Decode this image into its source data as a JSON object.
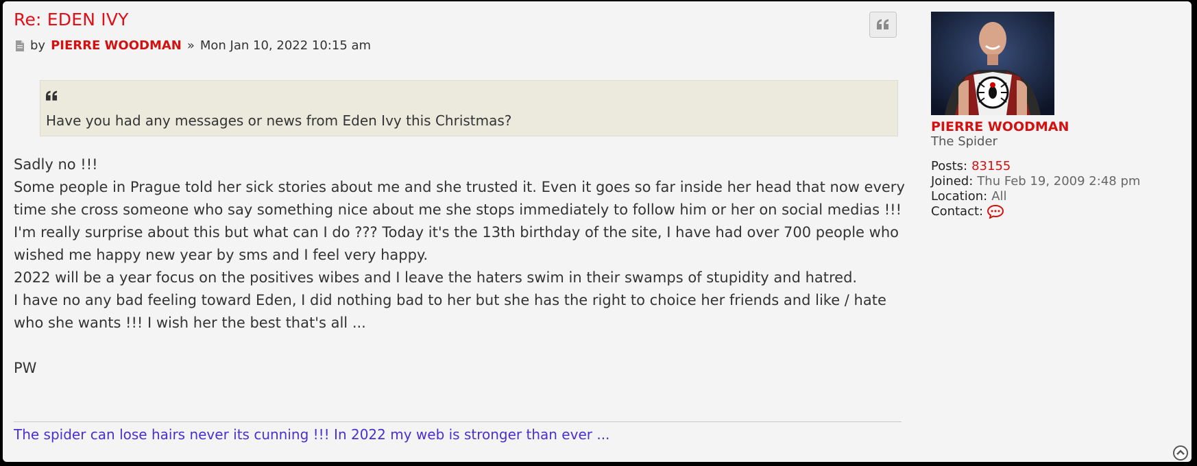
{
  "post": {
    "title": "Re: EDEN IVY",
    "by_label": "by",
    "author": "PIERRE WOODMAN",
    "separator": "»",
    "datetime": "Mon Jan 10, 2022 10:15 am"
  },
  "quote": {
    "text": "Have you had any messages or news from Eden Ivy this Christmas?"
  },
  "content": {
    "paragraphs": [
      "Sadly no !!!",
      "Some people in Prague told her sick stories about me and she trusted it. Even it goes so far inside her head that now every time she cross someone who say something nice about me she stops immediately to follow him or her on social medias !!!",
      "I'm really surprise about this but what can I do ??? Today it's the 13th birthday of the site, I have had over 700 people who wished me happy new year by sms and I feel very happy.",
      "2022 will be a year focus on the positives wibes and I leave the haters swim in their swamps of stupidity and hatred.",
      "I have no any bad feeling toward Eden, I did nothing bad to her but she has the right to choice her friends and like / hate who she wants !!! I wish her the best that's all ..."
    ],
    "signoff": "PW"
  },
  "signature": "The spider can lose hairs never its cunning !!! In 2022 my web is stronger than ever ...",
  "profile": {
    "name": "PIERRE WOODMAN",
    "rank": "The Spider",
    "posts_label": "Posts:",
    "posts_value": "83155",
    "joined_label": "Joined:",
    "joined_value": "Thu Feb 19, 2009 2:48 pm",
    "location_label": "Location:",
    "location_value": "All",
    "contact_label": "Contact:"
  },
  "icons": {
    "post": "document-icon",
    "quote": "quote-icon",
    "contact": "speech-bubble-icon",
    "top": "chevron-up-circle-icon"
  },
  "colors": {
    "title": "#e0101a",
    "author": "#d31111",
    "signature": "#4b2ed0",
    "quote_bg": "#ebeadd"
  }
}
